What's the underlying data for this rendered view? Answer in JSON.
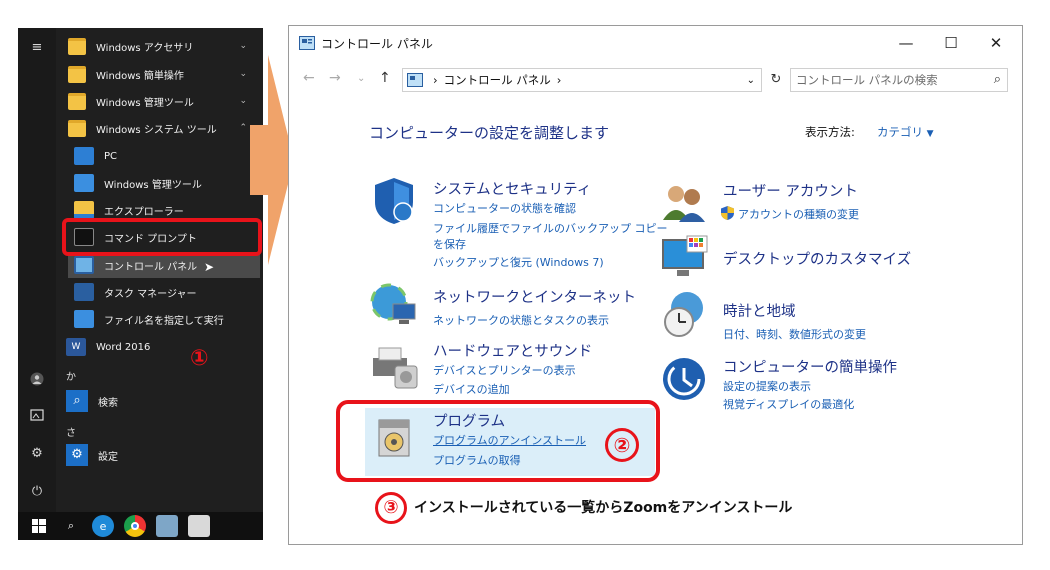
{
  "start_menu": {
    "items": [
      {
        "label": "Windows アクセサリ"
      },
      {
        "label": "Windows 簡単操作"
      },
      {
        "label": "Windows 管理ツール"
      },
      {
        "label": "Windows システム ツール"
      }
    ],
    "sub_items": [
      {
        "label": "PC"
      },
      {
        "label": "Windows 管理ツール"
      },
      {
        "label": "エクスプローラー"
      },
      {
        "label": "コマンド プロンプト"
      },
      {
        "label": "コントロール パネル"
      },
      {
        "label": "タスク マネージャー"
      },
      {
        "label": "ファイル名を指定して実行"
      }
    ],
    "word": "Word 2016",
    "letter_ka": "か",
    "search": "検索",
    "letter_sa": "さ",
    "settings": "設定",
    "step1": "①"
  },
  "control_panel": {
    "title": "コントロール パネル",
    "breadcrumb": "コントロール パネル",
    "search_placeholder": "コントロール パネルの検索",
    "heading": "コンピューターの設定を調整します",
    "view_by_label": "表示方法:",
    "view_by_value": "カテゴリ",
    "categories": {
      "system": {
        "title": "システムとセキュリティ",
        "links": [
          "コンピューターの状態を確認",
          "ファイル履歴でファイルのバックアップ コピー",
          "を保存",
          "バックアップと復元 (Windows 7)"
        ]
      },
      "network": {
        "title": "ネットワークとインターネット",
        "links": [
          "ネットワークの状態とタスクの表示"
        ]
      },
      "hardware": {
        "title": "ハードウェアとサウンド",
        "links": [
          "デバイスとプリンターの表示",
          "デバイスの追加"
        ]
      },
      "programs": {
        "title": "プログラム",
        "links": [
          "プログラムのアンインストール",
          "プログラムの取得"
        ]
      },
      "users": {
        "title": "ユーザー アカウント",
        "links": [
          "アカウントの種類の変更"
        ]
      },
      "desktop": {
        "title": "デスクトップのカスタマイズ"
      },
      "clock": {
        "title": "時計と地域",
        "links": [
          "日付、時刻、数値形式の変更"
        ]
      },
      "ease": {
        "title": "コンピューターの簡単操作",
        "links": [
          "設定の提案の表示",
          "視覚ディスプレイの最適化"
        ]
      }
    }
  },
  "annotations": {
    "step2": "②",
    "step3": "③",
    "step3_text": "インストールされている一覧からZoomをアンインストール"
  },
  "colors": {
    "highlight_red": "#e8131a",
    "link_blue": "#1a5fb4",
    "heading_blue": "#1e3287",
    "arrow_orange": "#f0a36a"
  }
}
